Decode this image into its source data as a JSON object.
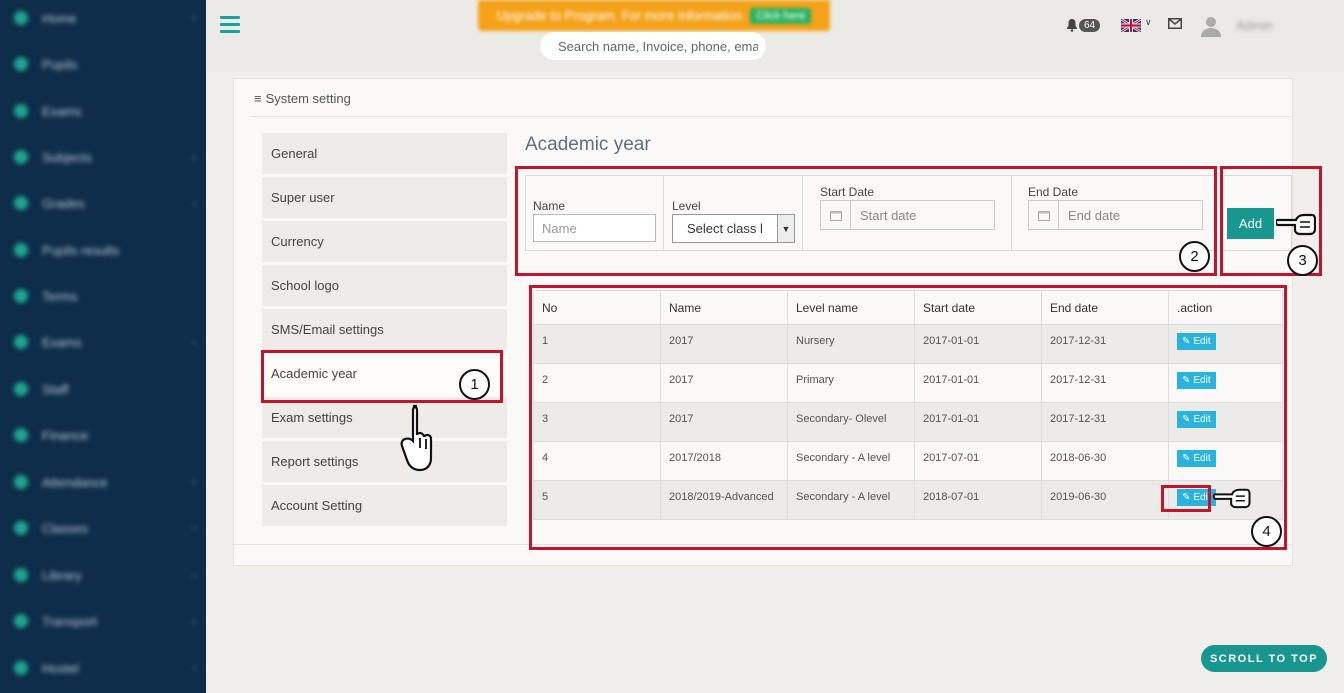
{
  "topbar": {
    "promo_text": "Upgrade to Program. For more information",
    "promo_button": "Click here",
    "search_placeholder": "Search name, Invoice, phone, ema",
    "notification_count": "64",
    "user_name": "Admin"
  },
  "sidebar": {
    "items": [
      {
        "label": "Home",
        "arrow": "‹"
      },
      {
        "label": "Pupils",
        "arrow": ""
      },
      {
        "label": "Exams",
        "arrow": ""
      },
      {
        "label": "Subjects",
        "arrow": "‹"
      },
      {
        "label": "Grades",
        "arrow": "‹"
      },
      {
        "label": "Pupils results",
        "arrow": ""
      },
      {
        "label": "Terms",
        "arrow": ""
      },
      {
        "label": "Exams",
        "arrow": "‹"
      },
      {
        "label": "Staff",
        "arrow": ""
      },
      {
        "label": "Finance",
        "arrow": ""
      },
      {
        "label": "Attendance",
        "arrow": "‹"
      },
      {
        "label": "Classes",
        "arrow": "‹"
      },
      {
        "label": "Library",
        "arrow": "‹"
      },
      {
        "label": "Transport",
        "arrow": "‹"
      },
      {
        "label": "Hostel",
        "arrow": "‹"
      }
    ]
  },
  "card": {
    "title": "System setting"
  },
  "settings_menu": [
    {
      "label": "General"
    },
    {
      "label": "Super user"
    },
    {
      "label": "Currency"
    },
    {
      "label": "School logo"
    },
    {
      "label": "SMS/Email settings"
    },
    {
      "label": "Academic year"
    },
    {
      "label": "Exam settings"
    },
    {
      "label": "Report settings"
    },
    {
      "label": "Account Setting"
    }
  ],
  "page_title": "Academic year",
  "form": {
    "name_label": "Name",
    "name_placeholder": "Name",
    "level_label": "Level",
    "level_selected": "Select class l",
    "start_label": "Start Date",
    "start_placeholder": "Start date",
    "end_label": "End Date",
    "end_placeholder": "End date",
    "add_label": "Add"
  },
  "table": {
    "headers": [
      "No",
      "Name",
      "Level name",
      "Start date",
      "End date",
      ".action"
    ],
    "edit_label": "Edit",
    "rows": [
      {
        "no": "1",
        "name": "2017",
        "level": "Nursery",
        "start": "2017-01-01",
        "end": "2017-12-31"
      },
      {
        "no": "2",
        "name": "2017",
        "level": "Primary",
        "start": "2017-01-01",
        "end": "2017-12-31"
      },
      {
        "no": "3",
        "name": "2017",
        "level": "Secondary- Olevel",
        "start": "2017-01-01",
        "end": "2017-12-31"
      },
      {
        "no": "4",
        "name": "2017/2018",
        "level": "Secondary - A level",
        "start": "2017-07-01",
        "end": "2018-06-30"
      },
      {
        "no": "5",
        "name": "2018/2019-Advanced",
        "level": "Secondary - A level",
        "start": "2018-07-01",
        "end": "2019-06-30"
      }
    ]
  },
  "annotations": {
    "n1": "1",
    "n2": "2",
    "n3": "3",
    "n4": "4"
  },
  "scroll_top": "SCROLL TO TOP",
  "colors": {
    "sidebar": "#0d2d4a",
    "accent": "#17978f",
    "annotation": "#c0152a",
    "edit": "#2bb3e0"
  }
}
